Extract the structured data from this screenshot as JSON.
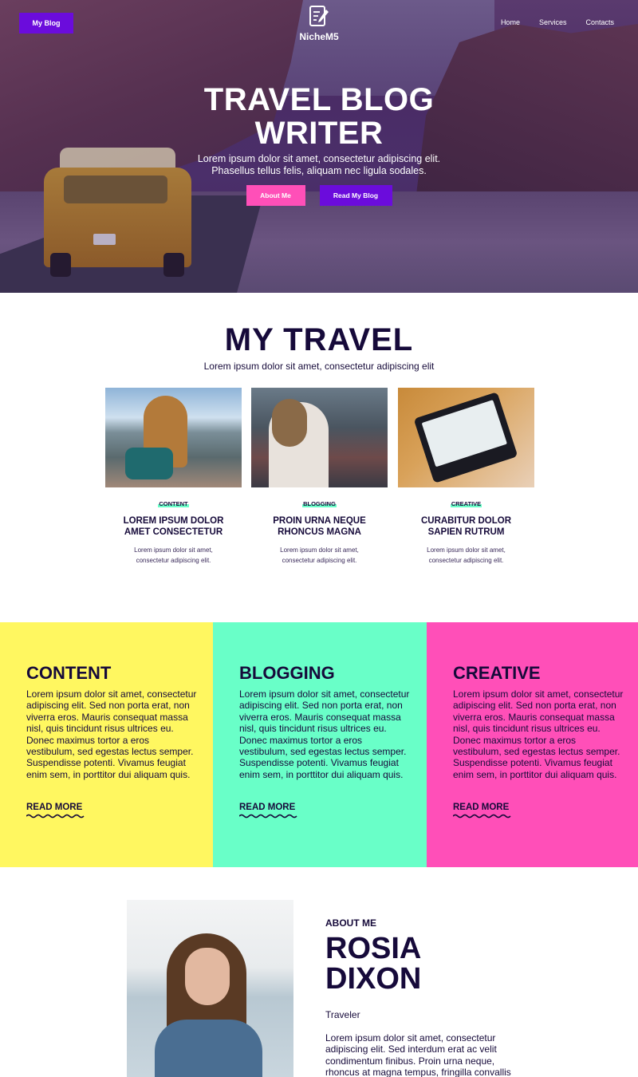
{
  "header": {
    "brand": "NicheM5",
    "my_blog_button": "My Blog",
    "nav": [
      "Home",
      "Services",
      "Contacts"
    ]
  },
  "hero": {
    "title_line1": "TRAVEL BLOG",
    "title_line2": "WRITER",
    "subtitle_line1": "Lorem ipsum dolor sit amet, consectetur adipiscing elit.",
    "subtitle_line2": "Phasellus tellus felis, aliquam nec ligula sodales.",
    "about_button": "About Me",
    "read_button": "Read My Blog"
  },
  "travel": {
    "title": "MY TRAVEL",
    "subtitle": "Lorem ipsum dolor sit amet, consectetur adipiscing elit",
    "cards": [
      {
        "tag": "CONTENT",
        "title_line1": "LOREM IPSUM DOLOR",
        "title_line2": "AMET CONSECTETUR",
        "text_line1": "Lorem ipsum dolor sit amet,",
        "text_line2": "consectetur adipiscing elit."
      },
      {
        "tag": "BLOGGING",
        "title_line1": "PROIN URNA NEQUE",
        "title_line2": "RHONCUS MAGNA",
        "text_line1": "Lorem ipsum dolor sit amet,",
        "text_line2": "consectetur adipiscing elit."
      },
      {
        "tag": "CREATIVE",
        "title_line1": "CURABITUR DOLOR",
        "title_line2": "SAPIEN RUTRUM",
        "text_line1": "Lorem ipsum dolor sit amet,",
        "text_line2": "consectetur adipiscing elit."
      }
    ]
  },
  "blocks": [
    {
      "title": "CONTENT",
      "text": "Lorem ipsum dolor sit amet, consectetur adipiscing elit. Sed non porta erat, non viverra eros. Mauris consequat massa nisl, quis tincidunt risus ultrices eu. Donec maximus tortor a eros vestibulum, sed egestas lectus semper. Suspendisse potenti. Vivamus feugiat enim sem, in porttitor dui aliquam quis.",
      "link": "READ MORE",
      "color": "#fff760"
    },
    {
      "title": "BLOGGING",
      "text": "Lorem ipsum dolor sit amet, consectetur adipiscing elit. Sed non porta erat, non viverra eros. Mauris consequat massa nisl, quis tincidunt risus ultrices eu. Donec maximus tortor a eros vestibulum, sed egestas lectus semper. Suspendisse potenti. Vivamus feugiat enim sem, in porttitor dui aliquam quis.",
      "link": "READ MORE",
      "color": "#69ffc8"
    },
    {
      "title": "CREATIVE",
      "text": "Lorem ipsum dolor sit amet, consectetur adipiscing elit. Sed non porta erat, non viverra eros. Mauris consequat massa nisl, quis tincidunt risus ultrices eu. Donec maximus tortor a eros vestibulum, sed egestas lectus semper. Suspendisse potenti. Vivamus feugiat enim sem, in porttitor dui aliquam quis.",
      "link": "READ MORE",
      "color": "#ff4fb8"
    }
  ],
  "about": {
    "label": "ABOUT ME",
    "name_line1": "ROSIA",
    "name_line2": "DIXON",
    "role": "Traveler",
    "text": "Lorem ipsum dolor sit amet, consectetur adipiscing elit. Sed interdum erat ac velit condimentum finibus. Proin urna neque, rhoncus at magna tempus, fringilla convallis"
  },
  "colors": {
    "accent_purple": "#6b0cdc",
    "accent_pink": "#ff4fb8",
    "accent_mint": "#69ffc8",
    "accent_yellow": "#fff760",
    "text_dark": "#160a3a"
  },
  "icons": {
    "logo": "document-pen-icon"
  }
}
